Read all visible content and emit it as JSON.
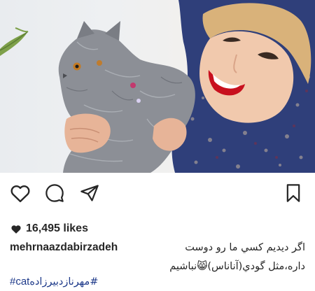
{
  "post": {
    "image": {
      "subject": "woman in blue headscarf holding grey Persian cat",
      "scarf_color": "#3b4a8c",
      "lip_color": "#c8101e",
      "cat_color": "#8c8f96",
      "background_color": "#eceef0"
    },
    "actions": {
      "like_icon": "heart-icon",
      "comment_icon": "comment-icon",
      "share_icon": "send-icon",
      "save_icon": "bookmark-icon"
    },
    "likes_text": "16,495 likes",
    "caption": {
      "username": "mehrnaazdabirzadeh",
      "line1": "اگر ديديم كسي ما رو دوست",
      "line2": "داره،مثل گودي(آناناس)😸نباشيم",
      "hashtag_user": "#مهرنازدبیرزاده",
      "hashtag_cat": "#cat"
    }
  }
}
